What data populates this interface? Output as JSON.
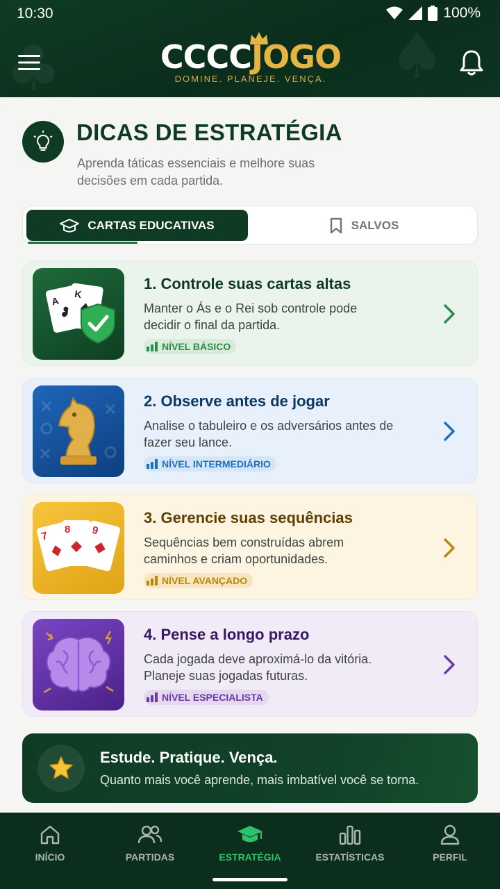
{
  "status_bar": {
    "time": "10:30",
    "battery": "100%"
  },
  "header": {
    "logo_white": "CCCC",
    "logo_gold": "JOGO",
    "tagline": "DOMINE. PLANEJE. VENÇA.",
    "menu_icon": "hamburger-menu-icon",
    "bell_icon": "bell-icon"
  },
  "page": {
    "title": "DICAS DE ESTRATÉGIA",
    "subtitle": "Aprenda táticas essenciais e melhore suas decisões em cada partida.",
    "title_icon": "lightbulb-icon"
  },
  "tabs": [
    {
      "label": "CARTAS EDUCATIVAS",
      "icon": "graduation-cap-icon",
      "active": true
    },
    {
      "label": "SALVOS",
      "icon": "bookmark-icon",
      "active": false
    }
  ],
  "cards": [
    {
      "title": "1. Controle suas cartas altas",
      "desc": "Manter o Ás e o Rei sob controle pode decidir o final da partida.",
      "level": "NÍVEL BÁSICO",
      "title_color": "#0f3b24",
      "accent": "#2e8b4a",
      "bg": "#eaf4ec",
      "badge_bg": "#d8ecdc",
      "image": "cards-shield-check"
    },
    {
      "title": "2. Observe antes de jogar",
      "desc": "Analise o tabuleiro e os adversários antes de fazer seu lance.",
      "level": "NÍVEL INTERMEDIÁRIO",
      "title_color": "#0d3a63",
      "accent": "#1f6fc0",
      "bg": "#e8f1fb",
      "badge_bg": "#d5e6f7",
      "image": "chess-knight"
    },
    {
      "title": "3. Gerencie suas sequências",
      "desc": "Sequências bem construídas abrem caminhos e criam oportunidades.",
      "level": "NÍVEL AVANÇADO",
      "title_color": "#5e4100",
      "accent": "#b7870f",
      "bg": "#fdf4e2",
      "badge_bg": "#f7e6bd",
      "image": "cards-7-8-9"
    },
    {
      "title": "4. Pense a longo prazo",
      "desc": "Cada jogada deve aproximá-lo da vitória. Planeje suas jogadas futuras.",
      "level": "NÍVEL ESPECIALISTA",
      "title_color": "#3a1762",
      "accent": "#6a3aa6",
      "bg": "#f0ebf6",
      "badge_bg": "#e4daf0",
      "image": "brain"
    }
  ],
  "banner": {
    "title": "Estude. Pratique. Vença.",
    "subtitle": "Quanto mais você aprende, mais imbatível você se torna.",
    "icon": "star-icon"
  },
  "nav": [
    {
      "label": "INÍCIO",
      "icon": "home-icon",
      "active": false
    },
    {
      "label": "PARTIDAS",
      "icon": "users-icon",
      "active": false
    },
    {
      "label": "ESTRATÉGIA",
      "icon": "graduation-cap-icon",
      "active": true
    },
    {
      "label": "ESTATÍSTICAS",
      "icon": "bar-chart-icon",
      "active": false
    },
    {
      "label": "PERFIL",
      "icon": "person-icon",
      "active": false
    }
  ]
}
